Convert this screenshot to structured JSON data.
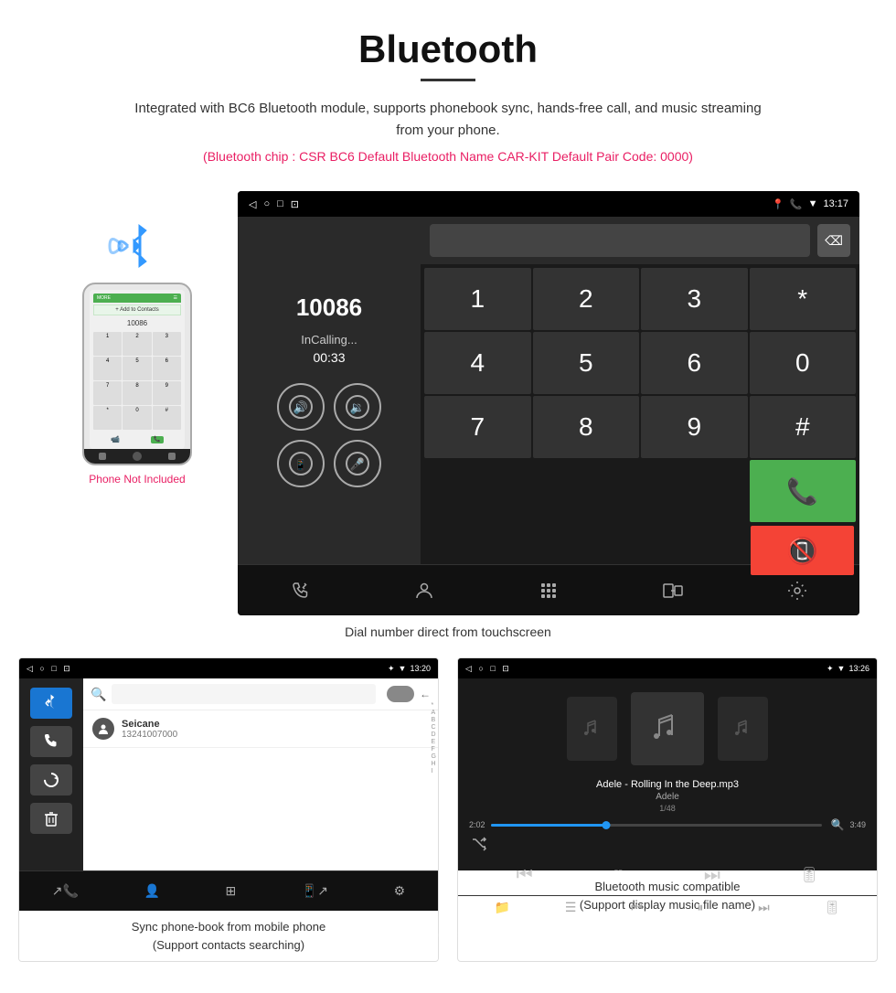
{
  "header": {
    "title": "Bluetooth",
    "description": "Integrated with BC6 Bluetooth module, supports phonebook sync, hands-free call, and music streaming from your phone.",
    "specs": "(Bluetooth chip : CSR BC6    Default Bluetooth Name CAR-KIT    Default Pair Code: 0000)"
  },
  "dial_screen": {
    "status_bar": {
      "nav_back": "◁",
      "nav_home": "○",
      "nav_recent": "□",
      "nav_cast": "⊡",
      "time": "13:17",
      "icons": [
        "📍",
        "📞",
        "▼"
      ]
    },
    "number": "10086",
    "status": "InCalling...",
    "timer": "00:33",
    "keypad": [
      "1",
      "2",
      "3",
      "*",
      "",
      "",
      "4",
      "5",
      "6",
      "0",
      "",
      "",
      "7",
      "8",
      "9",
      "#"
    ],
    "bottom_icons": [
      "↗📞",
      "👤",
      "⊞",
      "📱↗",
      "⚙"
    ]
  },
  "caption_dial": "Dial number direct from touchscreen",
  "phonebook_screen": {
    "status_bar": {
      "time": "13:20",
      "left_icons": "◁  ○  □  ⊡"
    },
    "contact": {
      "name": "Seicane",
      "number": "13241007000"
    },
    "alphabet": [
      "*",
      "A",
      "B",
      "C",
      "D",
      "E",
      "F",
      "G",
      "H",
      "I"
    ],
    "sidebar_icons": [
      "bluetooth",
      "phone",
      "refresh",
      "delete"
    ]
  },
  "caption_phonebook": "Sync phone-book from mobile phone\n(Support contacts searching)",
  "music_screen": {
    "status_bar": {
      "time": "13:26",
      "left_icons": "◁  ○  □  ⊡"
    },
    "track_name": "Adele - Rolling In the Deep.mp3",
    "artist": "Adele",
    "count": "1/48",
    "time_current": "2:02",
    "time_total": "3:49",
    "progress_pct": 35
  },
  "caption_music": "Bluetooth music compatible\n(Support display music file name)",
  "phone_label": "Phone Not Included"
}
